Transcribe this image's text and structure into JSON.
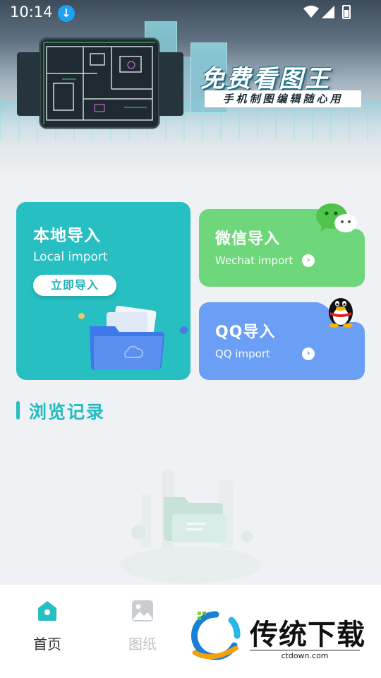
{
  "status_bar": {
    "time": "10:14",
    "icons": [
      "download-icon",
      "wifi-icon",
      "signal-icon",
      "battery-icon"
    ]
  },
  "banner": {
    "title": "免费看图王",
    "subtitle": "手机制图编辑随心用"
  },
  "cards": {
    "local": {
      "title": "本地导入",
      "subtitle": "Local import",
      "button": "立即导入",
      "color": "#27bfc2"
    },
    "wechat": {
      "title": "微信导入",
      "subtitle": "Wechat import",
      "color": "#6ed67b"
    },
    "qq": {
      "title": "QQ导入",
      "subtitle": "QQ import",
      "color": "#6a9ff5"
    }
  },
  "history": {
    "title": "浏览记录"
  },
  "bottom_nav": {
    "items": [
      {
        "label": "首页",
        "icon": "home-icon",
        "active": true
      },
      {
        "label": "图纸",
        "icon": "image-icon",
        "active": false
      }
    ]
  },
  "watermark": {
    "text": "传统下载",
    "url": "ctdown.com"
  }
}
